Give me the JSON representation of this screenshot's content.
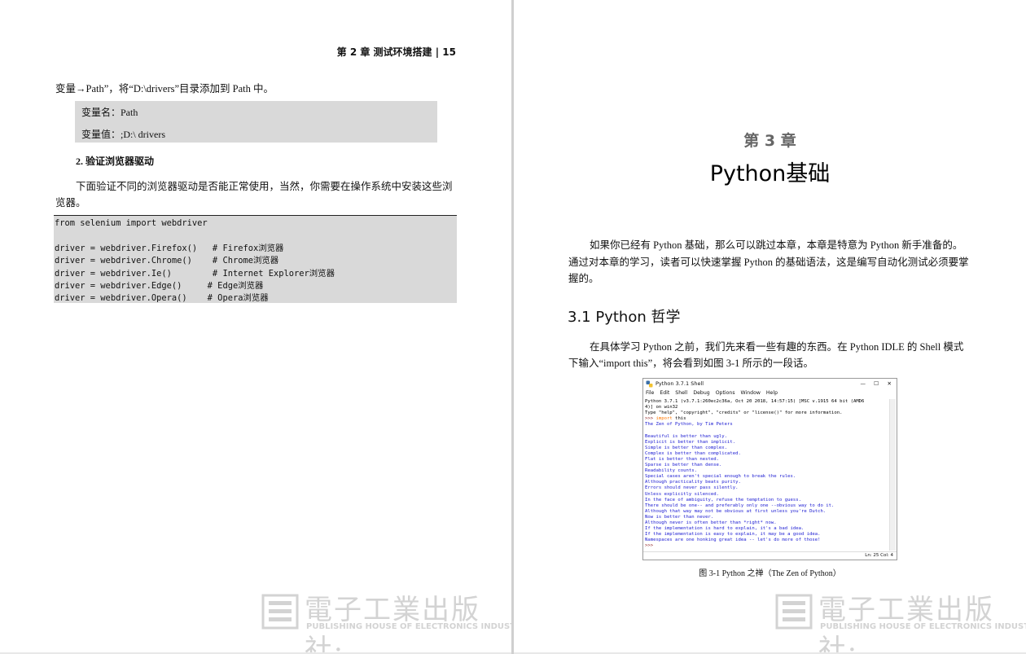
{
  "left_page": {
    "running_head": "第 2 章   测试环境搭建   |   15",
    "intro_line": "变量→Path”，将“D:\\drivers”目录添加到 Path 中。",
    "var_box": {
      "name_line": "变量名：Path",
      "value_line": "变量值：;D:\\ drivers"
    },
    "subheading": "2. 验证浏览器驱动",
    "para_line1": "下面验证不同的浏览器驱动是否能正常使用，当然，你需要在操作系统中安装这些浏",
    "para_line2": "览器。",
    "code_lines": [
      "from selenium import webdriver",
      "",
      "driver = webdriver.Firefox()   # Firefox浏览器",
      "driver = webdriver.Chrome()    # Chrome浏览器",
      "driver = webdriver.Ie()        # Internet Explorer浏览器",
      "driver = webdriver.Edge()     # Edge浏览器",
      "driver = webdriver.Opera()    # Opera浏览器"
    ]
  },
  "right_page": {
    "chapter_number": "第 3 章",
    "chapter_title": "Python基础",
    "intro_line1": "如果你已经有 Python 基础，那么可以跳过本章，本章是特意为 Python 新手准备的。",
    "intro_line2": "通过对本章的学习，读者可以快速掌握 Python 的基础语法，这是编写自动化测试必须要掌",
    "intro_line3": "握的。",
    "section_title": "3.1   Python 哲学",
    "body_line1": "在具体学习 Python 之前，我们先来看一些有趣的东西。在 Python IDLE 的 Shell 模式",
    "body_line2": "下输入“import this”，将会看到如图 3-1 所示的一段话。",
    "shell": {
      "title": "Python 3.7.1 Shell",
      "controls": [
        "—",
        "☐",
        "✕"
      ],
      "menu": [
        "File",
        "Edit",
        "Shell",
        "Debug",
        "Options",
        "Window",
        "Help"
      ],
      "header_lines": [
        "Python 3.7.1 (v3.7.1:260ec2c36a, Oct 20 2018, 14:57:15) [MSC v.1915 64 bit (AMD6",
        "4)] on win32",
        "Type \"help\", \"copyright\", \"credits\" or \"license()\" for more information."
      ],
      "prompt": ">>> ",
      "keyword": "import",
      "command_rest": " this",
      "zen_title": "The Zen of Python, by Tim Peters",
      "zen_lines": [
        "Beautiful is better than ugly.",
        "Explicit is better than implicit.",
        "Simple is better than complex.",
        "Complex is better than complicated.",
        "Flat is better than nested.",
        "Sparse is better than dense.",
        "Readability counts.",
        "Special cases aren't special enough to break the rules.",
        "Although practicality beats purity.",
        "Errors should never pass silently.",
        "Unless explicitly silenced.",
        "In the face of ambiguity, refuse the temptation to guess.",
        "There should be one-- and preferably only one --obvious way to do it.",
        "Although that way may not be obvious at first unless you're Dutch.",
        "Now is better than never.",
        "Although never is often better than *right* now.",
        "If the implementation is hard to explain, it's a bad idea.",
        "If the implementation is easy to explain, it may be a good idea.",
        "Namespaces are one honking great idea -- let's do more of those!"
      ],
      "last_prompt": ">>>",
      "status": "Ln: 25   Col: 4"
    },
    "figure_caption": "图 3-1   Python 之禅（The Zen of Python）"
  },
  "watermark": {
    "publisher_cn": "電子工業出版社·",
    "publisher_en": "PUBLISHING HOUSE OF ELECTRONICS INDUSTRY"
  },
  "colors": {
    "box_gray": "#d9d9d9",
    "shell_output_blue": "#1a1ad2",
    "shell_keyword_orange": "#ff7700",
    "shell_header": "#000000",
    "chapter_number_gray": "#666666"
  }
}
